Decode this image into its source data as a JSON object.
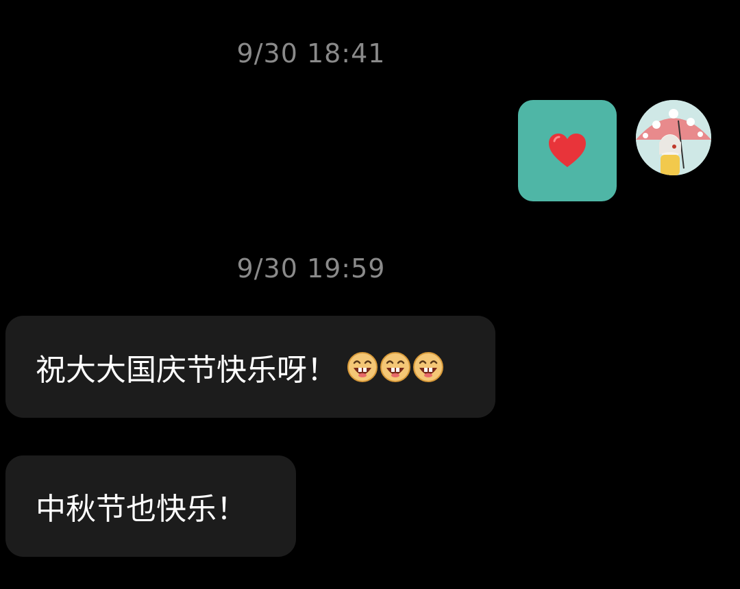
{
  "timestamps": [
    "9/30  18:41",
    "9/30  19:59"
  ],
  "sent_message": {
    "content_icon": "red-heart-icon",
    "bubble_color": "#4fb6a6"
  },
  "avatar": {
    "icon": "girl-with-umbrella-avatar"
  },
  "received_messages": [
    {
      "text": "祝大大国庆节快乐呀！",
      "emojis": [
        "grinning-face-icon",
        "grinning-face-icon",
        "grinning-face-icon"
      ]
    },
    {
      "text": "中秋节也快乐！"
    }
  ],
  "colors": {
    "background": "#000000",
    "received_bubble": "#1c1c1c",
    "timestamp_text": "#8a8a8a"
  }
}
